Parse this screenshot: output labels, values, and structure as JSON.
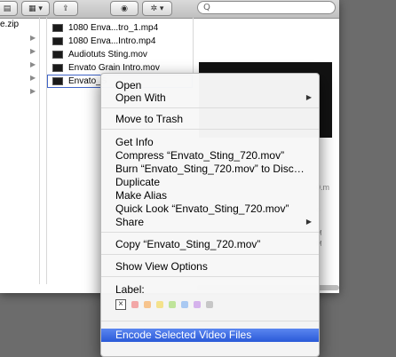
{
  "colors": {
    "desktop": "#6c6c6c",
    "highlight": "#3567e0",
    "label_swatches": [
      "#f2a7a7",
      "#f7c48d",
      "#f4e28c",
      "#bfe49a",
      "#a9c9f2",
      "#d5b2ec",
      "#c7c7c7"
    ]
  },
  "toolbar": {
    "view_icon": "list-view-icon",
    "arrange_icon": "grid-view-icon",
    "share_icon": "share-icon",
    "eye_icon": "quick-look-eye-icon",
    "action_icon": "gear-icon",
    "search_placeholder": "Q"
  },
  "sidebar_column": {
    "rows": [
      "e.zip",
      "",
      "",
      "",
      "",
      ""
    ]
  },
  "files": [
    {
      "name": "1080 Enva...tro_1.mp4",
      "selected": false
    },
    {
      "name": "1080 Enva...Intro.mp4",
      "selected": false
    },
    {
      "name": "Audiotuts Sting.mov",
      "selected": false
    },
    {
      "name": "Envato Grain Intro.mov",
      "selected": false
    },
    {
      "name": "Envato_S",
      "selected": true
    }
  ],
  "info_snippets": {
    "truncated": "0.m",
    "tick_a": "e",
    "tick_b": "M",
    "tick_c": "M"
  },
  "context_menu": {
    "open": "Open",
    "open_with": "Open With",
    "move_to_trash": "Move to Trash",
    "get_info": "Get Info",
    "compress": "Compress “Envato_Sting_720.mov”",
    "burn": "Burn “Envato_Sting_720.mov” to Disc…",
    "duplicate": "Duplicate",
    "make_alias": "Make Alias",
    "quick_look": "Quick Look “Envato_Sting_720.mov”",
    "share": "Share",
    "copy": "Copy “Envato_Sting_720.mov”",
    "show_view_options": "Show View Options",
    "label": "Label:",
    "label_none": "×",
    "encode": "Encode Selected Video Files"
  }
}
